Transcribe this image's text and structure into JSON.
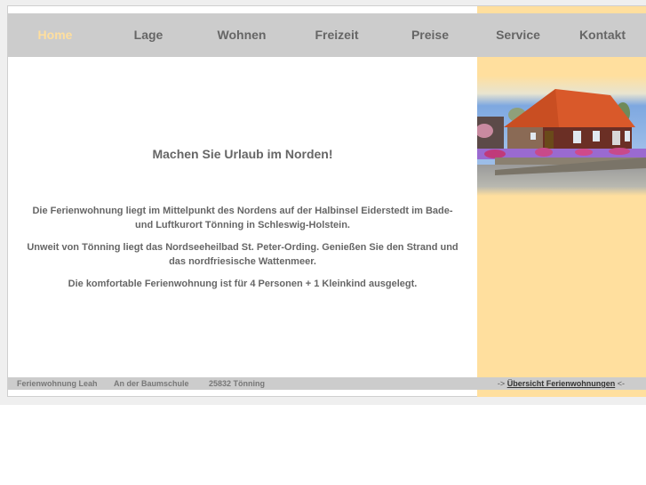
{
  "nav": {
    "items": [
      {
        "label": "Home",
        "active": true
      },
      {
        "label": "Lage",
        "active": false
      },
      {
        "label": "Wohnen",
        "active": false
      },
      {
        "label": "Freizeit",
        "active": false
      },
      {
        "label": "Preise",
        "active": false
      },
      {
        "label": "Service",
        "active": false
      },
      {
        "label": "Kontakt",
        "active": false
      }
    ]
  },
  "main": {
    "headline": "Machen Sie Urlaub im Norden!",
    "paragraphs": [
      "Die Ferienwohnung liegt im Mittelpunkt des Nordens auf der Halbinsel Eiderstedt im Bade- und Luftkurort Tönning in Schleswig-Holstein.",
      "Unweit von Tönning liegt das Nordseeheilbad St. Peter-Ording. Genießen Sie den Strand und das nordfriesische Wattenmeer.",
      "Die komfortable Ferienwohnung ist für 4 Personen + 1 Kleinkind ausgelegt."
    ]
  },
  "sidebar": {
    "photo_alt": "Ferienhaus mit rotem Dach und Blumen"
  },
  "footer": {
    "name": "Ferienwohnung Leah",
    "street": "An der Baumschule",
    "city": "25832 Tönning",
    "link_prefix": "->",
    "link_label": "Übersicht Ferienwohnungen",
    "link_suffix": "<-"
  },
  "colors": {
    "accent": "#ffdf9e",
    "nav_bg": "#cccccc",
    "text": "#666666"
  }
}
